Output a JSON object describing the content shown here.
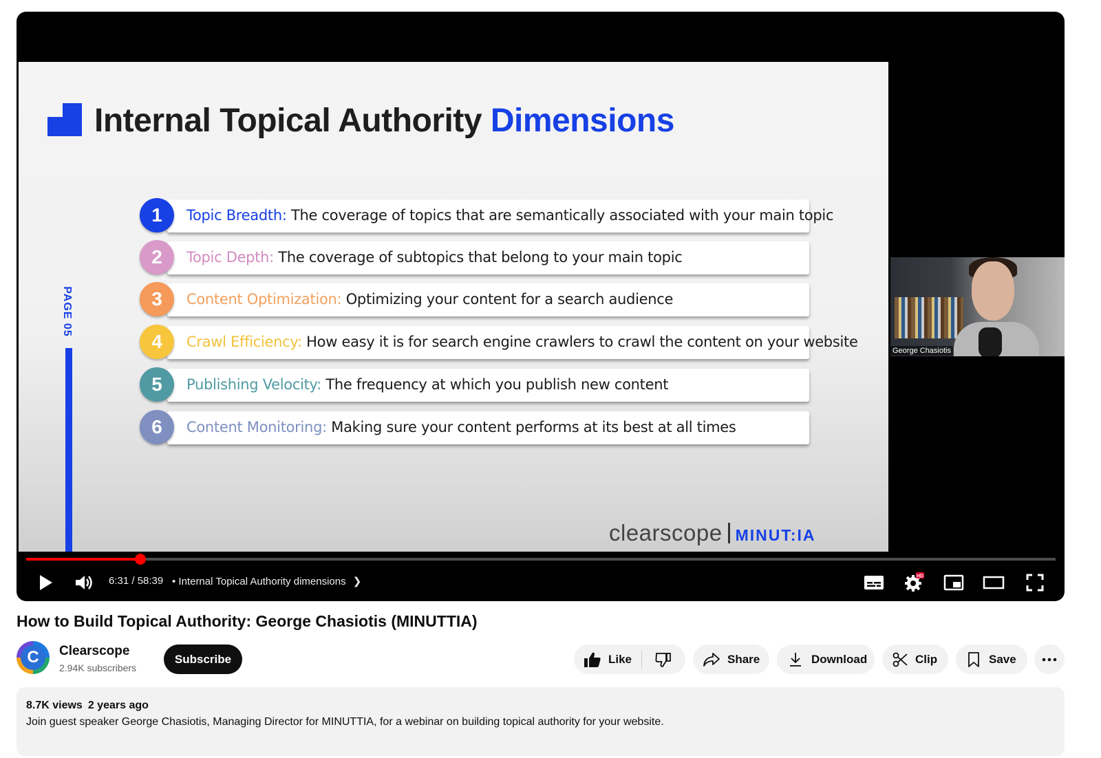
{
  "slide": {
    "title_main": "Internal Topical Authority ",
    "title_accent": "Dimensions",
    "page_label": "PAGE 05",
    "brand_left": "clearscope",
    "brand_right": "MINUT:IA",
    "dimensions": [
      {
        "num": "1",
        "label": "Topic Breadth:",
        "text": " The coverage of topics that are semantically associated with your main topic",
        "color": "#1740e5",
        "label_color": "#1740e5"
      },
      {
        "num": "2",
        "label": "Topic Depth:",
        "text": " The coverage of subtopics that belong to your main topic",
        "color": "#d99ac9",
        "label_color": "#d18cc0"
      },
      {
        "num": "3",
        "label": "Content Optimization:",
        "text": " Optimizing your content for a search audience",
        "color": "#f59a5a",
        "label_color": "#f2a05e"
      },
      {
        "num": "4",
        "label": "Crawl Efficiency:",
        "text": " How easy it is for search engine crawlers to crawl the content on your website",
        "color": "#f7c63d",
        "label_color": "#f2c23a"
      },
      {
        "num": "5",
        "label": "Publishing Velocity:",
        "text": " The frequency at which you publish new content",
        "color": "#4f9aa3",
        "label_color": "#4f9aa3"
      },
      {
        "num": "6",
        "label": "Content Monitoring:",
        "text": " Making sure your content performs at its best at all times",
        "color": "#7e8fc0",
        "label_color": "#7e8fc0"
      }
    ]
  },
  "webcam": {
    "name_tag": "George Chasiotis"
  },
  "player": {
    "time": "6:31 / 58:39",
    "chapter": "Internal Topical Authority dimensions",
    "progress_fraction": 0.111,
    "hd_badge": "HD",
    "accent": "#ff0000"
  },
  "video": {
    "title": "How to Build Topical Authority: George Chasiotis (MINUTTIA)",
    "channel": "Clearscope",
    "avatar_letter": "C",
    "subscribers": "2.94K subscribers",
    "subscribe_label": "Subscribe"
  },
  "actions": {
    "like": "Like",
    "share": "Share",
    "download": "Download",
    "clip": "Clip",
    "save": "Save"
  },
  "description": {
    "views": "8.7K views",
    "age": "2 years ago",
    "text": "Join guest speaker George Chasiotis, Managing Director for MINUTTIA, for a webinar on building topical authority for your website."
  }
}
